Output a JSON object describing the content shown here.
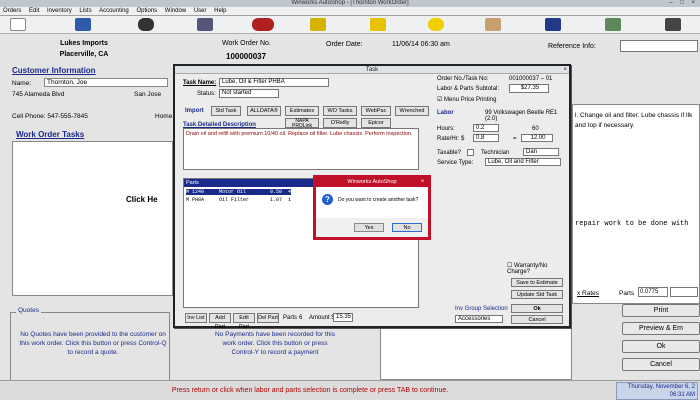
{
  "window": {
    "title": "Winworks AutoShop - [Thornton WorkOrder]",
    "controls": "– □ ×"
  },
  "menu": [
    "Orders",
    "Edit",
    "Inventory",
    "Lists",
    "Accounting",
    "Options",
    "Window",
    "User",
    "Help"
  ],
  "colors": {
    "accent": "#1a2a8a",
    "alert_red": "#c0102a",
    "status_text": "#b00000"
  },
  "toolbar": {
    "icons": [
      "document-icon",
      "people-icon",
      "binoculars-icon",
      "calculator-icon",
      "car-icon",
      "gold-bars-icon",
      "napa-icon",
      "handshake-icon",
      "truck-icon",
      "map-icon",
      "camera-icon"
    ]
  },
  "header": {
    "shop_name": "Lukes Imports",
    "shop_city": "Placerville, CA",
    "wo_label": "Work Order No.",
    "wo_number": "100000037",
    "order_date_label": "Order Date:",
    "order_date_value": "11/06/14  06:30 am",
    "reference_label": "Reference Info:"
  },
  "customer": {
    "section_title": "Customer Information",
    "name_label": "Name:",
    "name_value": "Thornton, Joe",
    "address": "745 Alameda Blvd",
    "city": "San Jose",
    "phone_label": "Cell Phone: 547-555-7845",
    "home_label": "Home"
  },
  "work_order_tasks": {
    "section_title": "Work Order Tasks",
    "click_here": "Click He"
  },
  "quotes": {
    "title": "Quotes",
    "text": "No Quotes have been provided to the customer on this work order. Click this button or press Control-Q to record a quote."
  },
  "payments": {
    "text": "No Payments have been recorded for this work order. Click this button or press Control-Y to record a payment"
  },
  "right_panel": {
    "notes": "l. Change oil and filter. Lube chassis if Ilk and top if necessary.",
    "repair_text": "repair work to be done with",
    "rates_label": "x Rates",
    "parts_label": "Parts",
    "parts_value": "0.0775",
    "buttons": [
      "Print",
      "Preview & Em",
      "Ok",
      "Cancel"
    ]
  },
  "status_bar": {
    "message": "Press return or click when labor and parts selection is complete or press TAB to continue.",
    "clock_line1": "Thursday, November 6, 2",
    "clock_line2": "06:31 AM"
  },
  "task_dialog": {
    "title": "Task",
    "close": "×",
    "task_name_label": "Task Name:",
    "task_name_value": "Lube, Oil & Filter PHBA",
    "status_label": "Status:",
    "status_value": "Not started",
    "order_task_label": "Order No./Task No:",
    "order_task_value": "001000037 – 01",
    "subtotal_label": "Labor & Parts Subtotal:",
    "subtotal_value": "$27.35",
    "menu_pricing": "Menu Price Printing",
    "buttons_row1": [
      "Import",
      "Std Task",
      "ALLDATA®",
      "Estimates",
      "WO Tasks",
      "WebPac",
      "Wrenched"
    ],
    "buttons_row2": [
      "NAPA PROLink",
      "O'Reilly",
      "Epicor"
    ],
    "desc_label": "Task Detailed Description",
    "description": "Drain oil and refill with premium 10/40 oil.  Replace oil filter.  Lube chassis.  Perform inspection.",
    "labor_label": "Labor",
    "vehicle": "99 Volkswagen Beetle RE1 (2.0)",
    "hours_label": "Hours:",
    "hours_value": "0.2",
    "rate_label": "Rate/Hr: $",
    "rate_value": "0.8",
    "rate_right": "60",
    "rate_total": "12.00",
    "taxable_label": "Taxable?",
    "technician_label": "Technician",
    "technician_value": "Dan",
    "service_type_label": "Service Type:",
    "service_type_value": "Lube, Oil and Filter",
    "parts_header": "Parts",
    "part_rows": [
      "M 1240     Motor Oil        0.50  4",
      "M PH8A     Oil Filter       1.07  1"
    ],
    "warranty_label": "Warranty/No Charge?",
    "save_estimate": "Save to Estimate",
    "update_std": "Update Std Task",
    "inv_group_label": "Inv Group Selection",
    "inv_group_value": "Accessories",
    "ok": "Ok",
    "cancel": "Cancel",
    "bottom_buttons": [
      "Inv List",
      "Add Part",
      "Edit Part",
      "Del Part"
    ],
    "parts_count_label": "Parts",
    "parts_count_value": "6",
    "amount_label": "Amount $",
    "amount_value": "15.35"
  },
  "message_box": {
    "title": "Winworks AutoShop",
    "close": "×",
    "question": "Do you want to create another task?",
    "yes": "Yes",
    "no": "No"
  }
}
